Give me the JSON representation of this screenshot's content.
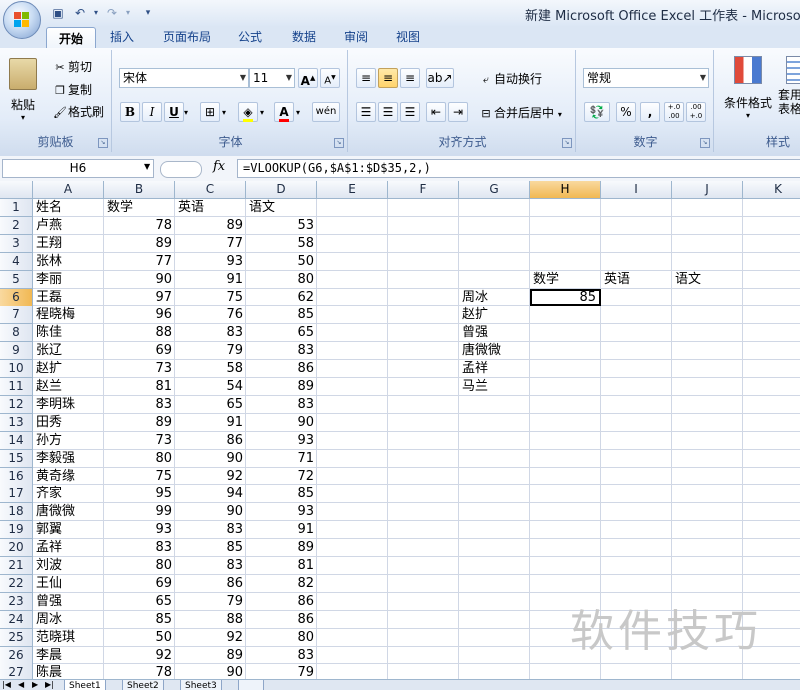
{
  "window": {
    "title": "新建 Microsoft Office Excel 工作表 - Microsoft E"
  },
  "ribbon": {
    "tabs": [
      "开始",
      "插入",
      "页面布局",
      "公式",
      "数据",
      "审阅",
      "视图"
    ],
    "clipboard": {
      "paste": "粘贴",
      "cut": "剪切",
      "copy": "复制",
      "format_painter": "格式刷",
      "group_label": "剪贴板"
    },
    "font": {
      "name": "宋体",
      "size": "11",
      "group_label": "字体",
      "bold": "B",
      "italic": "I",
      "underline": "U",
      "grow": "A",
      "shrink": "A",
      "wen": "wén"
    },
    "alignment": {
      "wrap_text": "自动换行",
      "merge_center": "合并后居中",
      "group_label": "对齐方式"
    },
    "number": {
      "format": "常规",
      "group_label": "数字",
      "percent": "%",
      "comma": ",",
      "inc_dec": "+.0 .00",
      "dec_dec": ".00 +.0"
    },
    "styles": {
      "conditional": "条件格式",
      "table_format": "套用\n表格格式",
      "group_label": "样式"
    }
  },
  "formula_bar": {
    "name_box": "H6",
    "fx": "fx",
    "formula": "=VLOOKUP(G6,$A$1:$D$35,2,)"
  },
  "columns": [
    "A",
    "B",
    "C",
    "D",
    "E",
    "F",
    "G",
    "H",
    "I",
    "J",
    "K"
  ],
  "selected": {
    "col": "H",
    "row": "6"
  },
  "table": {
    "headers": [
      "姓名",
      "数学",
      "英语",
      "语文"
    ],
    "rows": [
      [
        "卢燕",
        "78",
        "89",
        "53"
      ],
      [
        "王翔",
        "89",
        "77",
        "58"
      ],
      [
        "张林",
        "77",
        "93",
        "50"
      ],
      [
        "李丽",
        "90",
        "91",
        "80"
      ],
      [
        "王磊",
        "97",
        "75",
        "62"
      ],
      [
        "程晓梅",
        "96",
        "76",
        "85"
      ],
      [
        "陈佳",
        "88",
        "83",
        "65"
      ],
      [
        "张辽",
        "69",
        "79",
        "83"
      ],
      [
        "赵扩",
        "73",
        "58",
        "86"
      ],
      [
        "赵兰",
        "81",
        "54",
        "89"
      ],
      [
        "李明珠",
        "83",
        "65",
        "83"
      ],
      [
        "田秀",
        "89",
        "91",
        "90"
      ],
      [
        "孙方",
        "73",
        "86",
        "93"
      ],
      [
        "李毅强",
        "80",
        "90",
        "71"
      ],
      [
        "黄奇缘",
        "75",
        "92",
        "72"
      ],
      [
        "齐家",
        "95",
        "94",
        "85"
      ],
      [
        "唐微微",
        "99",
        "90",
        "93"
      ],
      [
        "郭翼",
        "93",
        "83",
        "91"
      ],
      [
        "孟祥",
        "83",
        "85",
        "89"
      ],
      [
        "刘波",
        "80",
        "83",
        "81"
      ],
      [
        "王仙",
        "69",
        "86",
        "82"
      ],
      [
        "曾强",
        "65",
        "79",
        "86"
      ],
      [
        "周冰",
        "85",
        "88",
        "86"
      ],
      [
        "范晓琪",
        "50",
        "92",
        "80"
      ],
      [
        "李晨",
        "92",
        "89",
        "83"
      ],
      [
        "陈晨",
        "78",
        "90",
        "79"
      ]
    ]
  },
  "lookup": {
    "headers": [
      "数学",
      "英语",
      "语文"
    ],
    "names": [
      "周冰",
      "赵扩",
      "曾强",
      "唐微微",
      "孟祥",
      "马兰"
    ],
    "result": "85"
  },
  "sheets": [
    "Sheet1",
    "Sheet2",
    "Sheet3"
  ],
  "watermark": "软件技巧"
}
